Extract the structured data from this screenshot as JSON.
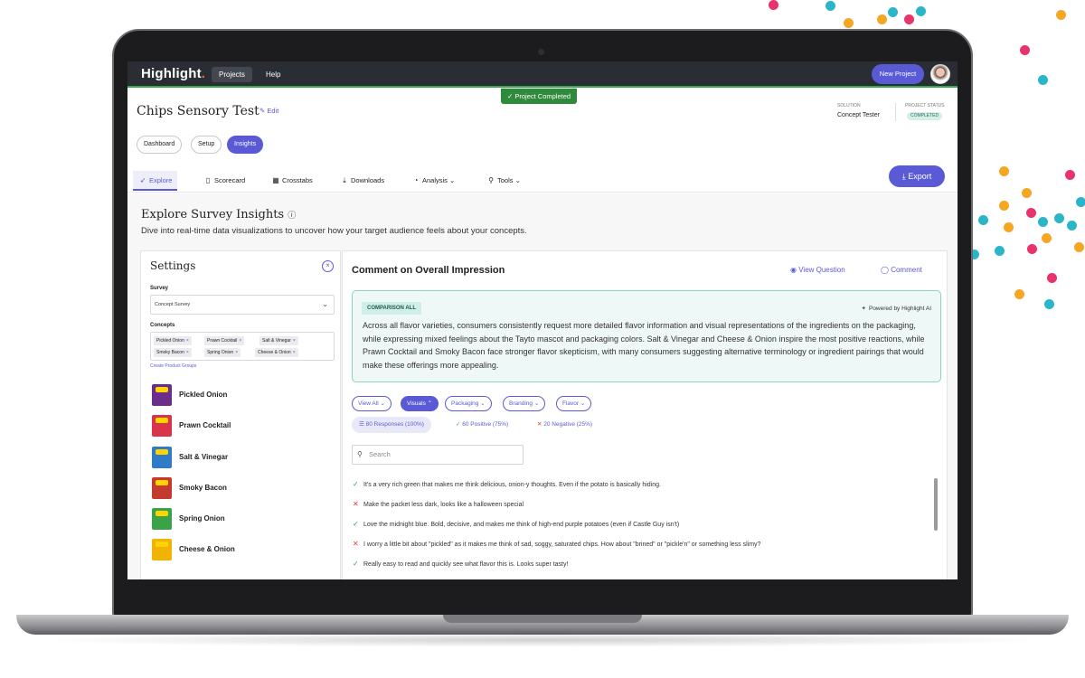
{
  "colors": {
    "accent": "#5b5ad6",
    "success": "#2fa84f",
    "danger": "#e03b3b",
    "teal_box": "#eef8f6"
  },
  "topnav": {
    "logo_main": "Highlight",
    "logo_mark": ".",
    "projects": "Projects",
    "help": "Help",
    "new_project": "New Project"
  },
  "status_banner": "Project Completed",
  "header": {
    "title": "Chips Sensory Test",
    "edit": "Edit",
    "solution_label": "SOLUTION",
    "solution_value": "Concept Tester",
    "status_label": "PROJECT STATUS",
    "status_value": "COMPLETED"
  },
  "pills": {
    "dashboard": "Dashboard",
    "setup": "Setup",
    "insights": "Insights"
  },
  "tabs": {
    "explore": "Explore",
    "scorecard": "Scorecard",
    "crosstabs": "Crosstabs",
    "downloads": "Downloads",
    "analysis": "Analysis",
    "tools": "Tools"
  },
  "export": "Export",
  "explore": {
    "title": "Explore Survey Insights",
    "subtitle": "Dive into real-time data visualizations to uncover how your target audience feels about your concepts."
  },
  "settings": {
    "title": "Settings",
    "survey_label": "Survey",
    "survey_value": "Concept Survey",
    "concepts_label": "Concepts",
    "chips": [
      "Pickled Onion",
      "Prawn Cocktail",
      "Salt & Vinegar",
      "Smoky Bacon",
      "Spring Onion",
      "Cheese & Onion"
    ],
    "create_groups": "Create Product Groups",
    "products": [
      {
        "name": "Pickled Onion",
        "color": "#6b2c8a"
      },
      {
        "name": "Prawn Cocktail",
        "color": "#d8344a"
      },
      {
        "name": "Salt & Vinegar",
        "color": "#2f7bc8"
      },
      {
        "name": "Smoky Bacon",
        "color": "#c53a2e"
      },
      {
        "name": "Spring Onion",
        "color": "#3aa34a"
      },
      {
        "name": "Cheese & Onion",
        "color": "#f0b400"
      }
    ]
  },
  "main": {
    "question": "Comment on Overall Impression",
    "view_question": "View Question",
    "comment": "Comment",
    "ai_tag": "COMPARISON ALL",
    "ai_powered": "Powered by Highlight AI",
    "ai_summary": "Across all flavor varieties, consumers consistently request more detailed flavor information and visual representations of the ingredients on the packaging, while expressing mixed feelings about the Tayto mascot and packaging colors. Salt & Vinegar and Cheese & Onion inspire the most positive reactions, while Prawn Cocktail and Smoky Bacon face stronger flavor skepticism, with many consumers suggesting alternative terminology or ingredient pairings that would make these offerings more appealing.",
    "filters": [
      "View All",
      "Visuals",
      "Packaging",
      "Branding",
      "Flavor"
    ],
    "stats": {
      "all": "80 Responses (100%)",
      "positive": "60 Positive (75%)",
      "negative": "20 Negative (25%)"
    },
    "search_placeholder": "Search",
    "responses": [
      {
        "sentiment": "positive",
        "text": "It's a very rich green that makes me think delicious, onion-y thoughts. Even if the potato is basically hiding."
      },
      {
        "sentiment": "negative",
        "text": "Make the packet less dark, looks like a halloween special"
      },
      {
        "sentiment": "positive",
        "text": "Love the midnight blue. Bold, decisive, and makes me think of high-end purple potatoes (even if Castle Guy isn't)"
      },
      {
        "sentiment": "negative",
        "text": "I worry a little bit about \"pickled\" as it makes me think of sad, soggy, saturated chips. How about \"brined\" or \"pickle'n\" or something less slimy?"
      },
      {
        "sentiment": "positive",
        "text": "Really easy to read and quickly see what flavor this is. Looks super tasty!"
      }
    ]
  }
}
